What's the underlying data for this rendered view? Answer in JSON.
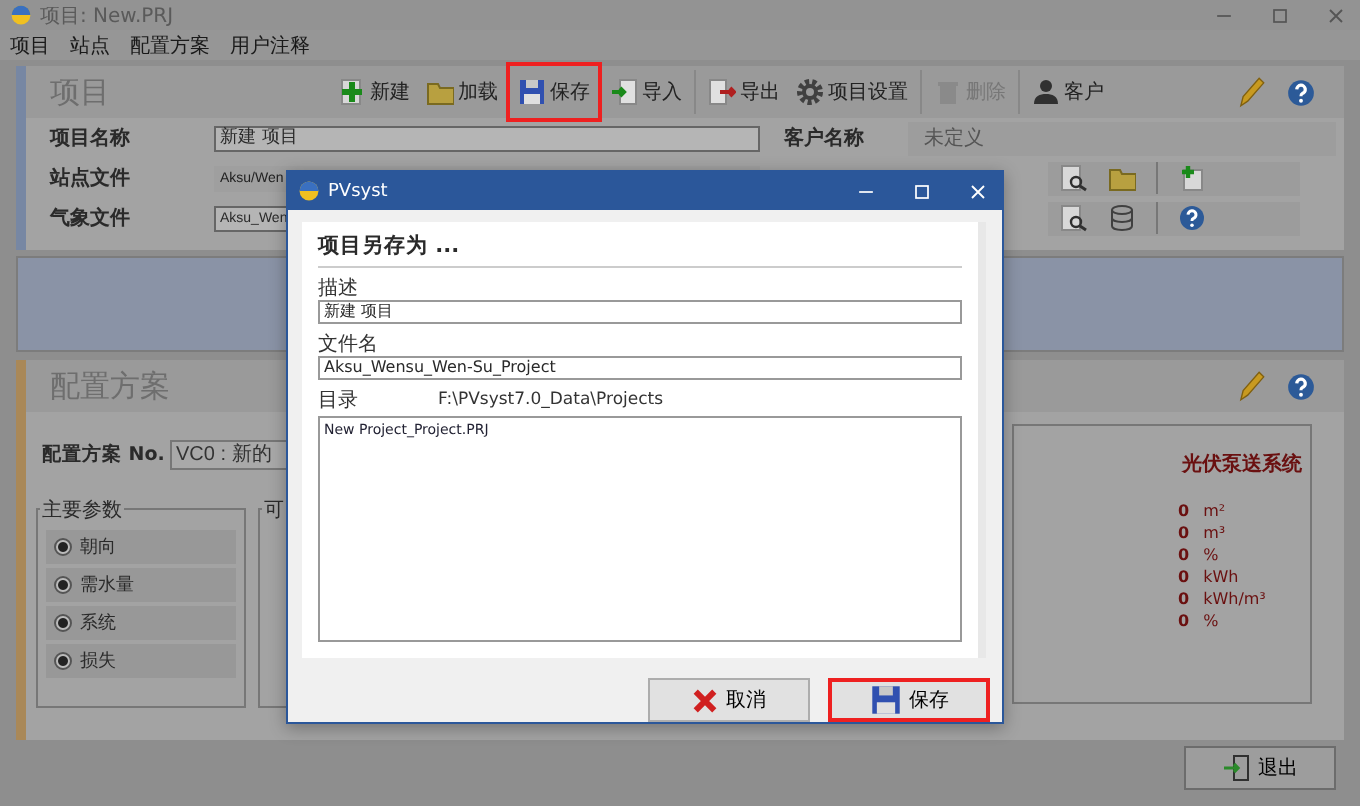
{
  "window": {
    "title": "项目: New.PRJ"
  },
  "menu": [
    "项目",
    "站点",
    "配置方案",
    "用户注释"
  ],
  "project_panel": {
    "title": "项目",
    "toolbar": [
      {
        "kind": "new",
        "label": "新建",
        "disabled": false,
        "highlighted": false
      },
      {
        "kind": "load",
        "label": "加载",
        "disabled": false,
        "highlighted": false
      },
      {
        "kind": "save",
        "label": "保存",
        "disabled": false,
        "highlighted": true
      },
      {
        "kind": "import",
        "label": "导入",
        "disabled": false,
        "highlighted": false
      },
      {
        "kind": "export",
        "label": "导出",
        "disabled": false,
        "highlighted": false
      },
      {
        "kind": "settings",
        "label": "项目设置",
        "disabled": false,
        "highlighted": false
      },
      {
        "kind": "delete",
        "label": "删除",
        "disabled": true,
        "highlighted": false
      },
      {
        "kind": "client",
        "label": "客户",
        "disabled": false,
        "highlighted": false
      }
    ],
    "fields": [
      {
        "kind": "name",
        "label": "项目名称",
        "value": "新建 项目"
      },
      {
        "kind": "site",
        "label": "站点文件",
        "value": "Aksu/Wen"
      },
      {
        "kind": "meteo",
        "label": "气象文件",
        "value": "Aksu_Wen"
      }
    ],
    "customer": {
      "label": "客户名称",
      "value": "未定义"
    }
  },
  "variant_panel": {
    "title": "配置方案",
    "number_label": "配置方案 No.",
    "variant": "VC0 : 新的",
    "groups": [
      {
        "title": "主要参数",
        "items": [
          {
            "label": "朝向",
            "on": true
          },
          {
            "label": "需水量",
            "on": true
          },
          {
            "label": "系统",
            "on": true
          },
          {
            "label": "损失",
            "on": true
          }
        ]
      },
      {
        "title": "可"
      }
    ],
    "results": {
      "title": "光伏泵送系统",
      "rows": [
        {
          "value": "0",
          "unit": "m²"
        },
        {
          "value": "0",
          "unit": "m³"
        },
        {
          "value": "0",
          "unit": "%"
        },
        {
          "value": "0",
          "unit": "kWh"
        },
        {
          "value": "0",
          "unit": "kWh/m³"
        },
        {
          "value": "0",
          "unit": "%"
        }
      ]
    }
  },
  "exit_button": {
    "label": "退出"
  },
  "dialog": {
    "title": "PVsyst",
    "heading": "项目另存为 ...",
    "description": {
      "label": "描述",
      "value": "新建 项目"
    },
    "file_name": {
      "label": "文件名",
      "value": "Aksu_Wensu_Wen-Su_Project"
    },
    "directory": {
      "label": "目录",
      "path": "F:\\PVsyst7.0_Data\\Projects"
    },
    "files": [
      "New Project_Project.PRJ"
    ],
    "buttons": [
      {
        "kind": "cancel",
        "label": "取消",
        "highlighted": false
      },
      {
        "kind": "save",
        "label": "保存",
        "highlighted": true
      }
    ]
  }
}
